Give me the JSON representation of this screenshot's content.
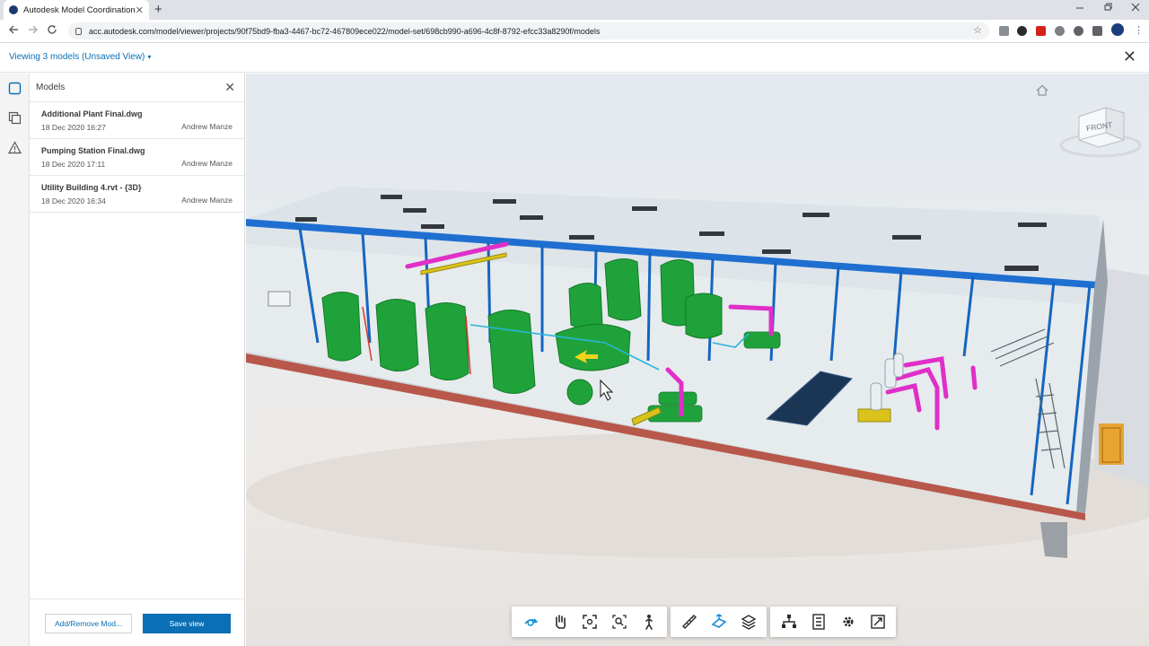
{
  "browser": {
    "tab_title": "Autodesk Model Coordination",
    "tab_close": "✕",
    "new_tab": "+",
    "url": "acc.autodesk.com/model/viewer/projects/90f75bd9-fba3-4467-bc72-467809ece022/model-set/698cb990-a696-4c8f-8792-efcc33a8290f/models"
  },
  "header": {
    "viewing_label": "Viewing 3 models (Unsaved View)",
    "caret": "▾",
    "close": "✕"
  },
  "panel": {
    "title": "Models",
    "close": "✕",
    "models": [
      {
        "name": "Additional Plant Final.dwg",
        "date": "18 Dec 2020 16:27",
        "author": "Andrew Manze"
      },
      {
        "name": "Pumping Station Final.dwg",
        "date": "18 Dec 2020 17:11",
        "author": "Andrew Manze"
      },
      {
        "name": "Utility Building 4.rvt - {3D}",
        "date": "18 Dec 2020 16:34",
        "author": "Andrew Manze"
      }
    ],
    "add_remove_label": "Add/Remove Mod...",
    "save_view_label": "Save view"
  },
  "viewcube": {
    "face_label": "FRONT"
  },
  "toolbar": {
    "groups": [
      [
        "orbit-icon",
        "pan-icon",
        "fit-to-view-icon",
        "zoom-window-icon",
        "first-person-icon"
      ],
      [
        "measure-icon",
        "section-icon",
        "layers-icon"
      ],
      [
        "model-browser-icon",
        "properties-icon",
        "settings-icon",
        "fullscreen-icon"
      ]
    ],
    "active": [
      "orbit-icon",
      "section-icon"
    ],
    "accent_color": "#0a8bd6"
  },
  "colors": {
    "accent": "#0a6fb5",
    "equipment_green": "#1fa23a",
    "pipe_magenta": "#e02fc8",
    "steel_blue": "#1565c0"
  }
}
